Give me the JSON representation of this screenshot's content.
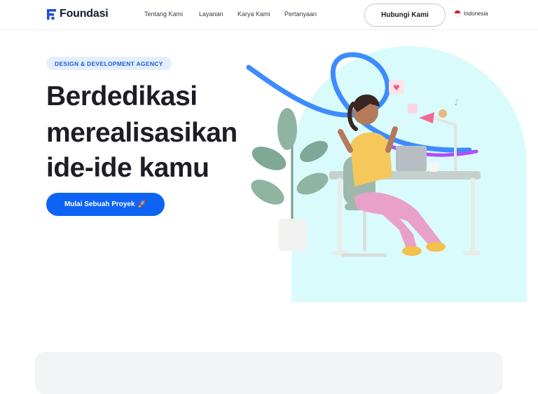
{
  "header": {
    "brand": "Foundasi",
    "nav": [
      "Tentang Kami",
      "Layanan",
      "Karya Kami",
      "Pertanyaan"
    ],
    "contact_button": "Hubungi Kami",
    "language": "Indonesia"
  },
  "hero": {
    "badge": "DESIGN & DEVELOPMENT AGENCY",
    "headline_lines": [
      "Berdedikasi",
      "merealisasikan",
      "ide-ide kamu"
    ],
    "cta_label": "Mulai Sebuah Proyek",
    "cta_icon": "rocket-icon"
  },
  "colors": {
    "accent": "#0d63f4",
    "badge_bg": "#e4eefc",
    "hero_bg": "#d9fbfb",
    "text_dark": "#1e1d26"
  }
}
